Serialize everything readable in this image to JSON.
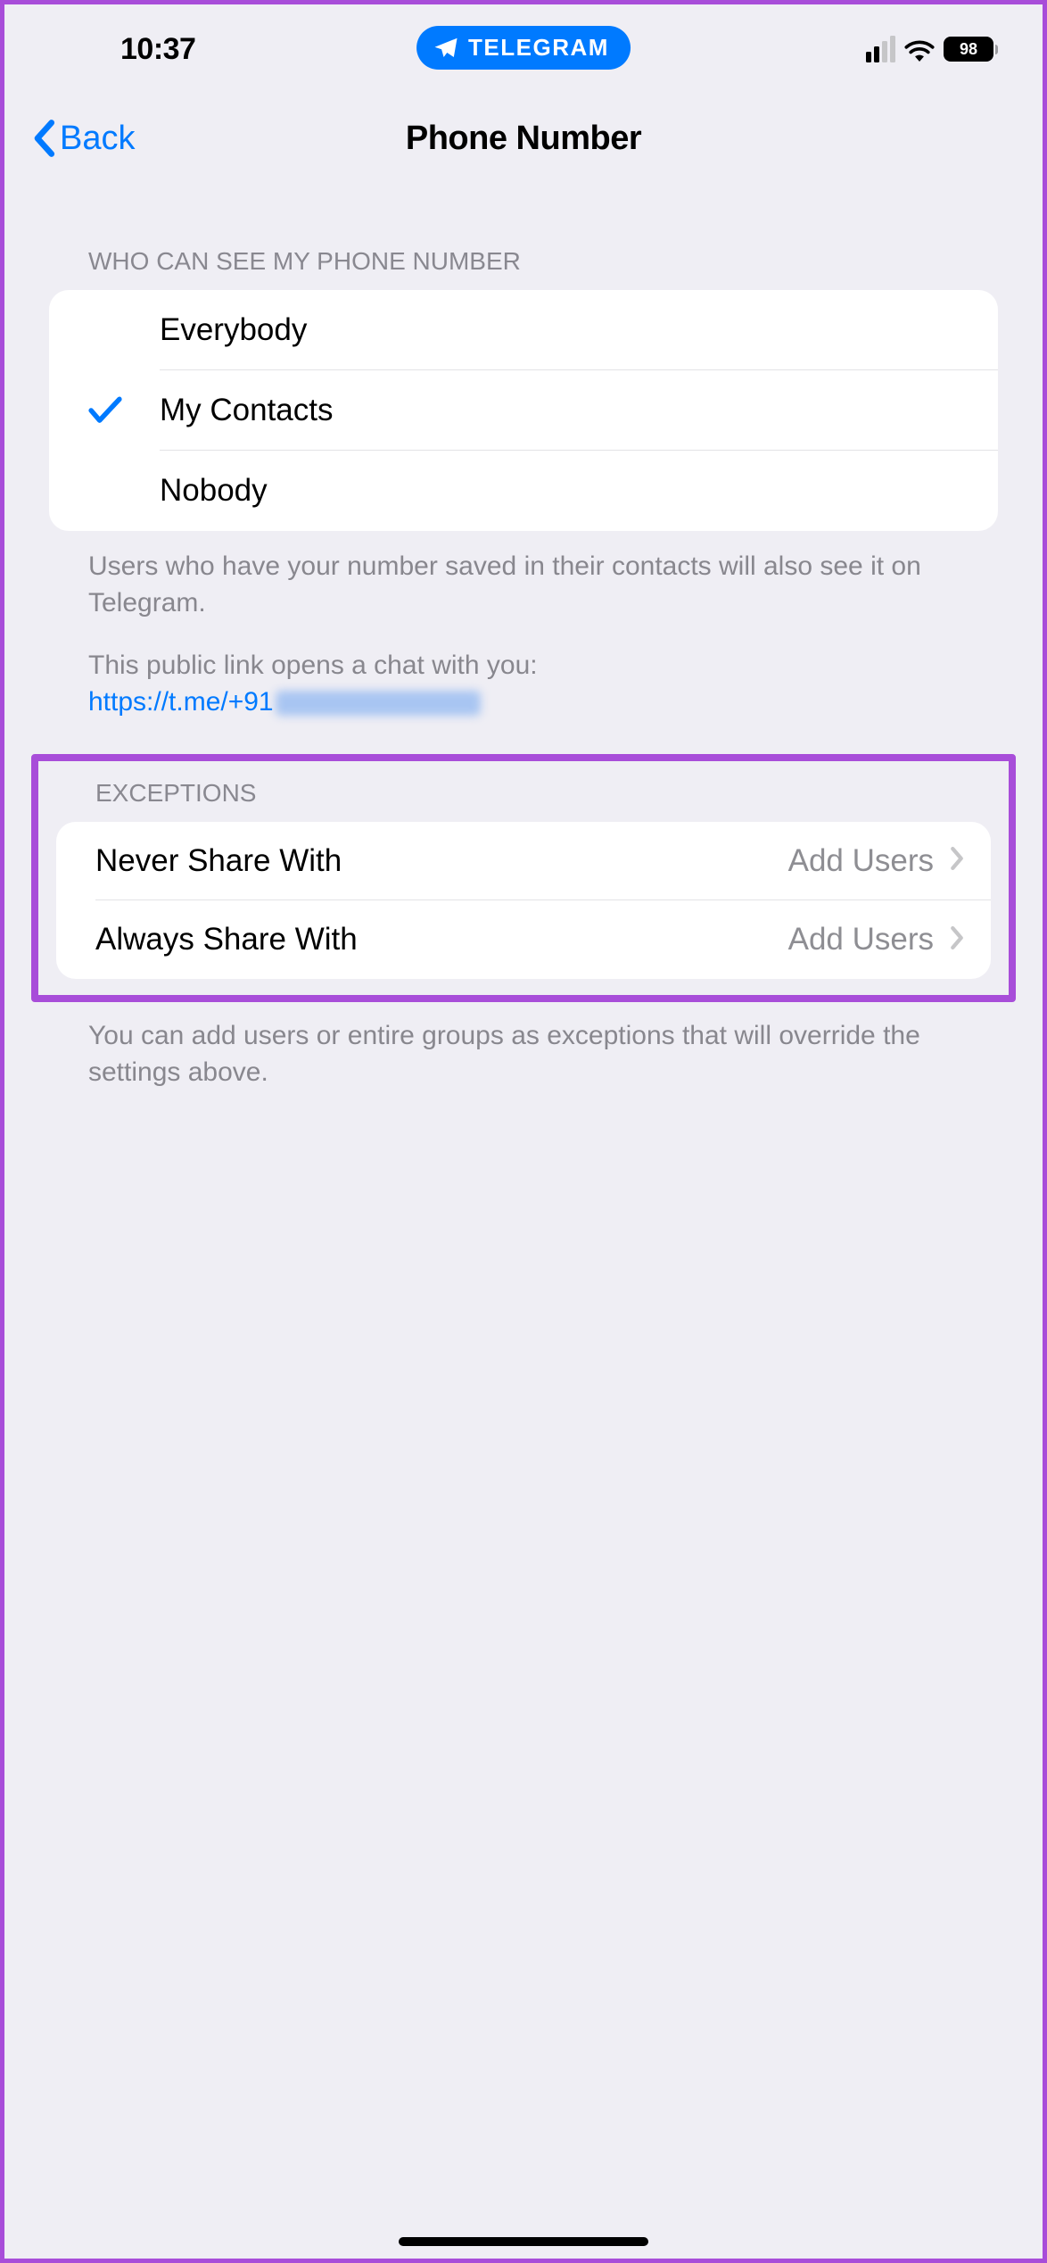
{
  "status": {
    "time": "10:37",
    "app_pill": "TELEGRAM",
    "battery": "98"
  },
  "nav": {
    "back": "Back",
    "title": "Phone Number"
  },
  "section1": {
    "header": "Who can see my phone number",
    "options": [
      {
        "label": "Everybody",
        "selected": false
      },
      {
        "label": "My Contacts",
        "selected": true
      },
      {
        "label": "Nobody",
        "selected": false
      }
    ],
    "footer1": "Users who have your number saved in their contacts will also see it on Telegram.",
    "footer2": "This public link opens a chat with you:",
    "link": "https://t.me/+91"
  },
  "section2": {
    "header": "Exceptions",
    "rows": [
      {
        "label": "Never Share With",
        "value": "Add Users"
      },
      {
        "label": "Always Share With",
        "value": "Add Users"
      }
    ],
    "footer": "You can add users or entire groups as exceptions that will override the settings above."
  }
}
